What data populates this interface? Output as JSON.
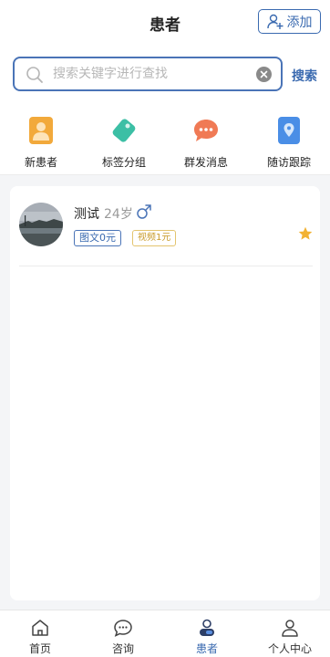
{
  "header": {
    "title": "患者",
    "add_label": "添加"
  },
  "search": {
    "placeholder": "搜索关键字进行查找",
    "value": "",
    "button_label": "搜索"
  },
  "quick_actions": [
    {
      "label": "新患者",
      "icon": "new-patient-icon"
    },
    {
      "label": "标签分组",
      "icon": "tag-icon"
    },
    {
      "label": "群发消息",
      "icon": "chat-bubble-icon"
    },
    {
      "label": "随访跟踪",
      "icon": "location-pin-icon"
    }
  ],
  "patients": [
    {
      "name": "测试",
      "age": "24岁",
      "gender": "male-icon",
      "tags": [
        "图文0元",
        "视频1元"
      ],
      "starred": true
    }
  ],
  "tabbar": [
    {
      "label": "首页",
      "icon": "home-icon"
    },
    {
      "label": "咨询",
      "icon": "message-icon"
    },
    {
      "label": "患者",
      "icon": "patient-icon",
      "active": true
    },
    {
      "label": "个人中心",
      "icon": "profile-icon"
    }
  ],
  "colors": {
    "accent": "#3a6ab0",
    "star": "#f2b233",
    "tag_video": "#c99b2a",
    "background": "#f4f5f7"
  }
}
